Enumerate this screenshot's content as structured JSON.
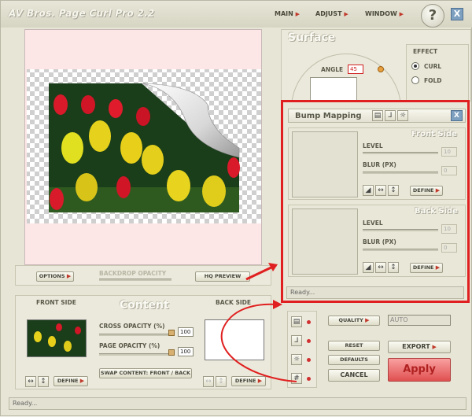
{
  "app": {
    "title": "AV Bros. Page Curl Pro 2.2"
  },
  "menu": {
    "main": "MAIN",
    "adjust": "ADJUST",
    "window": "WINDOW",
    "help": "?",
    "close": "X"
  },
  "preview": {
    "options": "OPTIONS",
    "backdrop_opacity": "BACKDROP OPACITY",
    "hq_preview": "HQ PREVIEW"
  },
  "surface": {
    "heading": "Surface",
    "angle_label": "ANGLE",
    "angle_value": "45",
    "effect_label": "EFFECT",
    "curl": "CURL",
    "fold": "FOLD"
  },
  "bump": {
    "title": "Bump Mapping",
    "front_heading": "Front Side",
    "back_heading": "Back Side",
    "level": "LEVEL",
    "blur": "BLUR (PX)",
    "front_level_val": "10",
    "front_blur_val": "0",
    "back_level_val": "10",
    "back_blur_val": "0",
    "define": "DEFINE",
    "status": "Ready..."
  },
  "content": {
    "front_side": "FRONT SIDE",
    "heading": "Content",
    "back_side": "BACK SIDE",
    "cross_opacity": "CROSS OPACITY (%)",
    "cross_value": "100",
    "page_opacity": "PAGE OPACITY (%)",
    "page_value": "100",
    "swap": "SWAP CONTENT: FRONT / BACK",
    "define": "DEFINE"
  },
  "render": {
    "quality": "QUALITY",
    "quality_value": "AUTO",
    "reset": "RESET",
    "defaults": "DEFAULTS",
    "cancel": "CANCEL",
    "export": "EXPORT",
    "apply": "Apply"
  },
  "statusbar": {
    "text": "Ready..."
  },
  "colors": {
    "accent_red": "#e02020",
    "apply_bg": "#f07070",
    "page_pink": "#fde6e6"
  }
}
